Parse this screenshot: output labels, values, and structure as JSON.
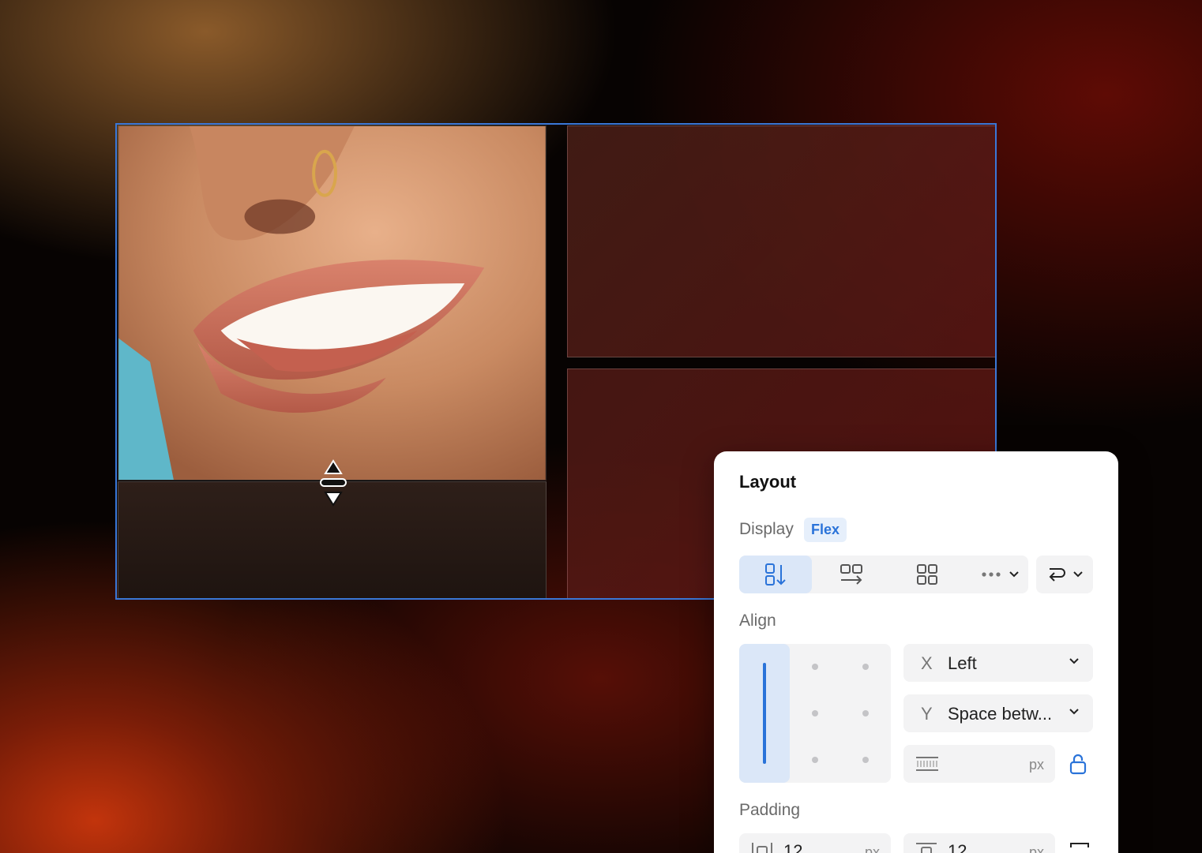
{
  "panel": {
    "title": "Layout",
    "display_label": "Display",
    "display_value": "Flex",
    "direction_options": [
      "vertical-stack-icon",
      "horizontal-stack-icon",
      "grid-icon",
      "more-icon"
    ],
    "align_label": "Align",
    "align_x": {
      "axis": "X",
      "value": "Left"
    },
    "align_y": {
      "axis": "Y",
      "value": "Space betw..."
    },
    "gap": {
      "value": "",
      "unit": "px"
    },
    "padding_label": "Padding",
    "padding_horizontal": {
      "value": "12",
      "unit": "px"
    },
    "padding_vertical": {
      "value": "12",
      "unit": "px"
    }
  },
  "colors": {
    "selection": "#3a78d8",
    "accent": "#2a73d9",
    "panel_bg": "#ffffff"
  }
}
